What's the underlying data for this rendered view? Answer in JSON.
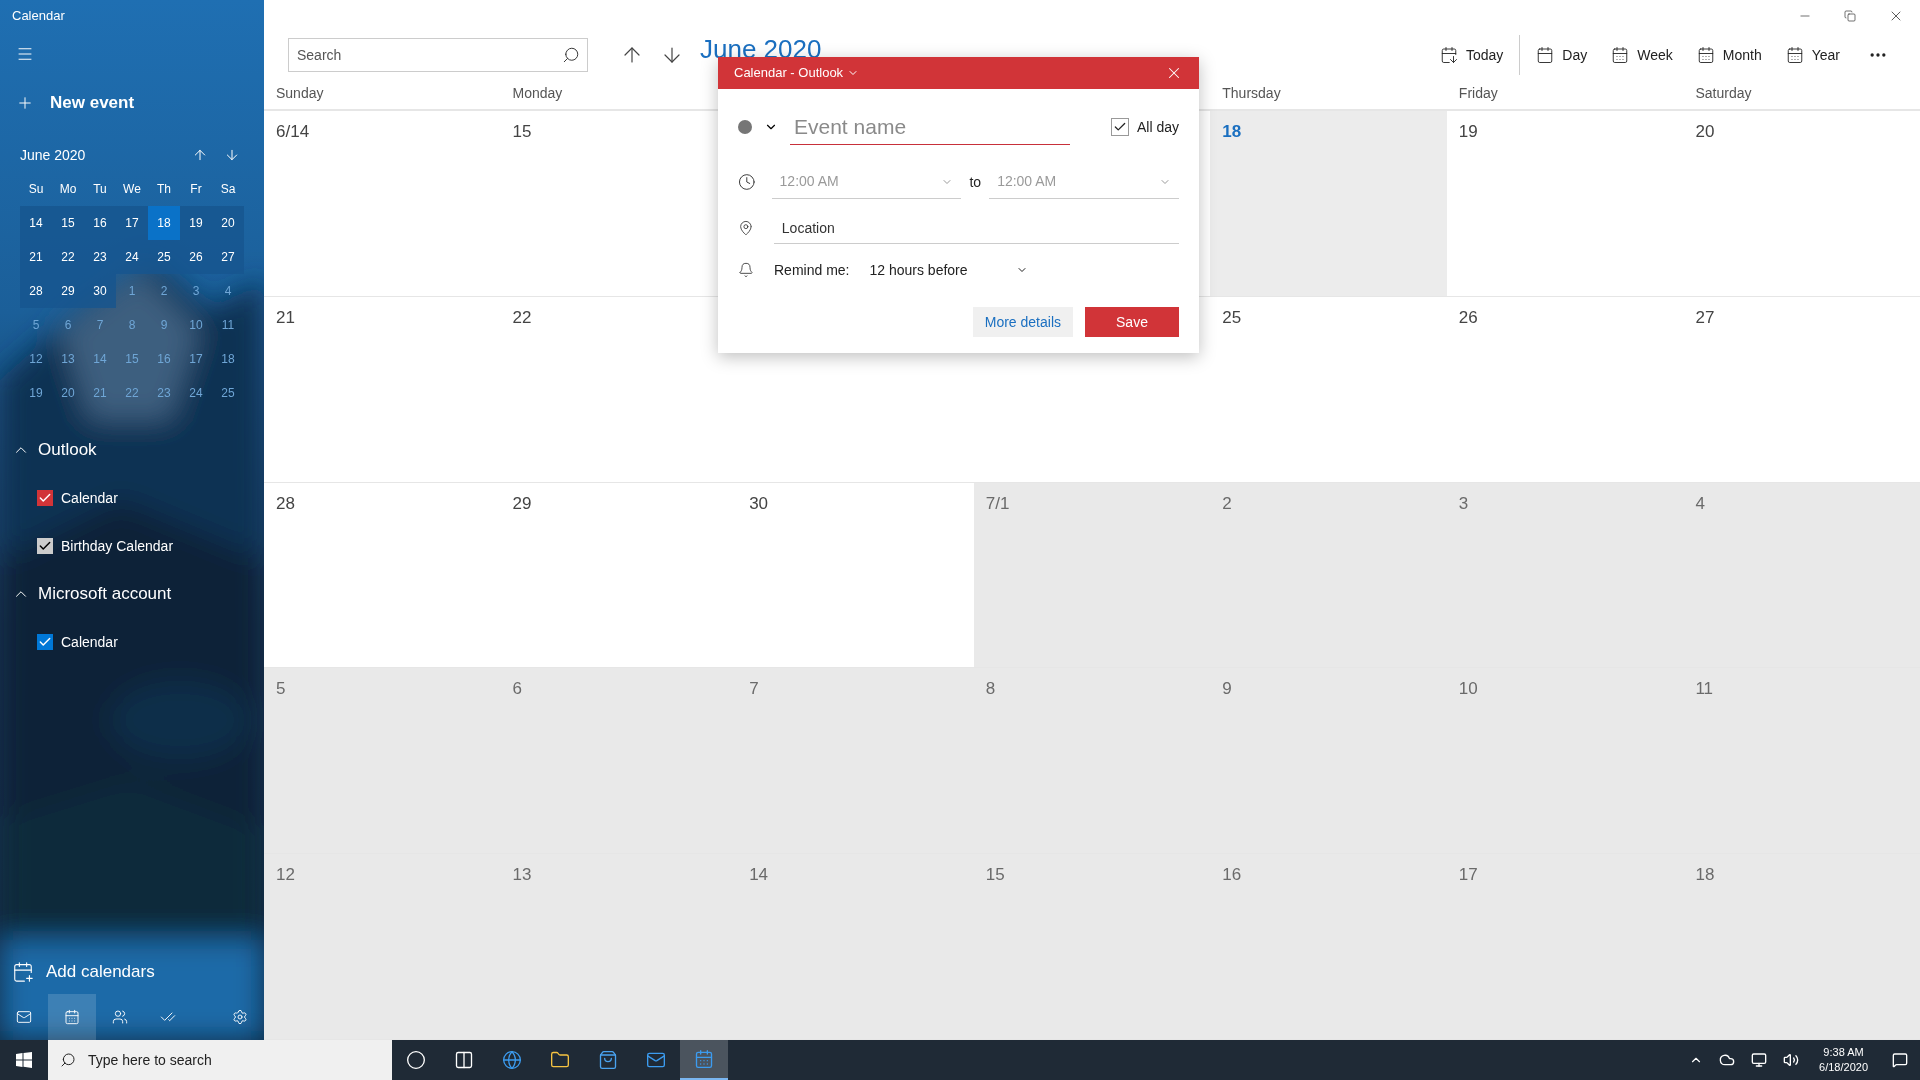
{
  "window": {
    "title": "Calendar"
  },
  "sidebar": {
    "new_event": "New event",
    "mini_calendar": {
      "month": "June 2020",
      "weekdays": [
        "Su",
        "Mo",
        "Tu",
        "We",
        "Th",
        "Fr",
        "Sa"
      ],
      "days": [
        {
          "label": "14",
          "in_view": true,
          "today": false
        },
        {
          "label": "15",
          "in_view": true,
          "today": false
        },
        {
          "label": "16",
          "in_view": true,
          "today": false
        },
        {
          "label": "17",
          "in_view": true,
          "today": false
        },
        {
          "label": "18",
          "in_view": true,
          "today": true
        },
        {
          "label": "19",
          "in_view": true,
          "today": false
        },
        {
          "label": "20",
          "in_view": true,
          "today": false
        },
        {
          "label": "21",
          "in_view": true,
          "today": false
        },
        {
          "label": "22",
          "in_view": true,
          "today": false
        },
        {
          "label": "23",
          "in_view": true,
          "today": false
        },
        {
          "label": "24",
          "in_view": true,
          "today": false
        },
        {
          "label": "25",
          "in_view": true,
          "today": false
        },
        {
          "label": "26",
          "in_view": true,
          "today": false
        },
        {
          "label": "27",
          "in_view": true,
          "today": false
        },
        {
          "label": "28",
          "in_view": true,
          "today": false
        },
        {
          "label": "29",
          "in_view": true,
          "today": false
        },
        {
          "label": "30",
          "in_view": true,
          "today": false
        },
        {
          "label": "1",
          "in_view": false,
          "today": false
        },
        {
          "label": "2",
          "in_view": false,
          "today": false
        },
        {
          "label": "3",
          "in_view": false,
          "today": false
        },
        {
          "label": "4",
          "in_view": false,
          "today": false
        },
        {
          "label": "5",
          "in_view": false,
          "today": false
        },
        {
          "label": "6",
          "in_view": false,
          "today": false
        },
        {
          "label": "7",
          "in_view": false,
          "today": false
        },
        {
          "label": "8",
          "in_view": false,
          "today": false
        },
        {
          "label": "9",
          "in_view": false,
          "today": false
        },
        {
          "label": "10",
          "in_view": false,
          "today": false
        },
        {
          "label": "11",
          "in_view": false,
          "today": false
        },
        {
          "label": "12",
          "in_view": false,
          "today": false
        },
        {
          "label": "13",
          "in_view": false,
          "today": false
        },
        {
          "label": "14",
          "in_view": false,
          "today": false
        },
        {
          "label": "15",
          "in_view": false,
          "today": false
        },
        {
          "label": "16",
          "in_view": false,
          "today": false
        },
        {
          "label": "17",
          "in_view": false,
          "today": false
        },
        {
          "label": "18",
          "in_view": false,
          "today": false
        },
        {
          "label": "19",
          "in_view": false,
          "today": false
        },
        {
          "label": "20",
          "in_view": false,
          "today": false
        },
        {
          "label": "21",
          "in_view": false,
          "today": false
        },
        {
          "label": "22",
          "in_view": false,
          "today": false
        },
        {
          "label": "23",
          "in_view": false,
          "today": false
        },
        {
          "label": "24",
          "in_view": false,
          "today": false
        },
        {
          "label": "25",
          "in_view": false,
          "today": false
        }
      ]
    },
    "accounts": [
      {
        "name": "Outlook",
        "expanded": true,
        "calendars": [
          {
            "name": "Calendar",
            "checked": true,
            "color": "#d13438"
          },
          {
            "name": "Birthday Calendar",
            "checked": true,
            "color": "#cccccc"
          }
        ]
      },
      {
        "name": "Microsoft account",
        "expanded": true,
        "calendars": [
          {
            "name": "Calendar",
            "checked": true,
            "color": "#0078d7"
          }
        ]
      }
    ],
    "add_calendars": "Add calendars",
    "nav": [
      {
        "kind": "mail",
        "selected": false
      },
      {
        "kind": "calendar",
        "selected": true
      },
      {
        "kind": "people",
        "selected": false
      },
      {
        "kind": "todo",
        "selected": false
      },
      {
        "kind": "settings",
        "selected": false
      }
    ]
  },
  "toolbar": {
    "search_placeholder": "Search",
    "title": "June 2020",
    "views": [
      {
        "kind": "today",
        "label": "Today"
      },
      {
        "kind": "day",
        "label": "Day"
      },
      {
        "kind": "week",
        "label": "Week"
      },
      {
        "kind": "month",
        "label": "Month"
      },
      {
        "kind": "year",
        "label": "Year"
      }
    ]
  },
  "month_grid": {
    "weekdays_left": [
      "Sunday",
      "Monday"
    ],
    "weekdays_right": [
      "Thursday",
      "Friday",
      "Saturday"
    ],
    "rows": [
      [
        {
          "label": "6/14",
          "in_month": true,
          "today": false
        },
        {
          "label": "15",
          "in_month": true,
          "today": false
        },
        null,
        null,
        {
          "label": "18",
          "in_month": true,
          "today": true
        },
        {
          "label": "19",
          "in_month": true,
          "today": false
        },
        {
          "label": "20",
          "in_month": true,
          "today": false
        }
      ],
      [
        {
          "label": "21",
          "in_month": true,
          "today": false
        },
        {
          "label": "22",
          "in_month": true,
          "today": false
        },
        null,
        null,
        {
          "label": "25",
          "in_month": true,
          "today": false
        },
        {
          "label": "26",
          "in_month": true,
          "today": false
        },
        {
          "label": "27",
          "in_month": true,
          "today": false
        }
      ],
      [
        {
          "label": "28",
          "in_month": true,
          "today": false
        },
        {
          "label": "29",
          "in_month": true,
          "today": false
        },
        {
          "label": "30",
          "in_month": true,
          "today": false
        },
        {
          "label": "7/1",
          "in_month": false,
          "today": false
        },
        {
          "label": "2",
          "in_month": false,
          "today": false
        },
        {
          "label": "3",
          "in_month": false,
          "today": false
        },
        {
          "label": "4",
          "in_month": false,
          "today": false
        }
      ],
      [
        {
          "label": "5",
          "in_month": false,
          "today": false
        },
        {
          "label": "6",
          "in_month": false,
          "today": false
        },
        {
          "label": "7",
          "in_month": false,
          "today": false
        },
        {
          "label": "8",
          "in_month": false,
          "today": false
        },
        {
          "label": "9",
          "in_month": false,
          "today": false
        },
        {
          "label": "10",
          "in_month": false,
          "today": false
        },
        {
          "label": "11",
          "in_month": false,
          "today": false
        }
      ],
      [
        {
          "label": "12",
          "in_month": false,
          "today": false
        },
        {
          "label": "13",
          "in_month": false,
          "today": false
        },
        {
          "label": "14",
          "in_month": false,
          "today": false
        },
        {
          "label": "15",
          "in_month": false,
          "today": false
        },
        {
          "label": "16",
          "in_month": false,
          "today": false
        },
        {
          "label": "17",
          "in_month": false,
          "today": false
        },
        {
          "label": "18",
          "in_month": false,
          "today": false
        }
      ]
    ]
  },
  "event_dialog": {
    "header": "Calendar - Outlook",
    "name_placeholder": "Event name",
    "all_day": {
      "label": "All day",
      "checked": true
    },
    "start": "12:00 AM",
    "to": "to",
    "end": "12:00 AM",
    "times_disabled": true,
    "location_placeholder": "Location",
    "remind_label": "Remind me:",
    "remind_value": "12 hours before",
    "buttons": [
      {
        "kind": "secondary",
        "label": "More details"
      },
      {
        "kind": "primary",
        "label": "Save"
      }
    ]
  },
  "taskbar": {
    "search_placeholder": "Type here to search",
    "apps": [
      {
        "kind": "cortana",
        "selected": false
      },
      {
        "kind": "task_view",
        "selected": false
      },
      {
        "kind": "browser",
        "selected": false
      },
      {
        "kind": "files",
        "selected": false
      },
      {
        "kind": "store",
        "selected": false
      },
      {
        "kind": "mail",
        "selected": false
      },
      {
        "kind": "calendar",
        "selected": true
      }
    ],
    "time": "9:38 AM",
    "date": "6/18/2020"
  }
}
